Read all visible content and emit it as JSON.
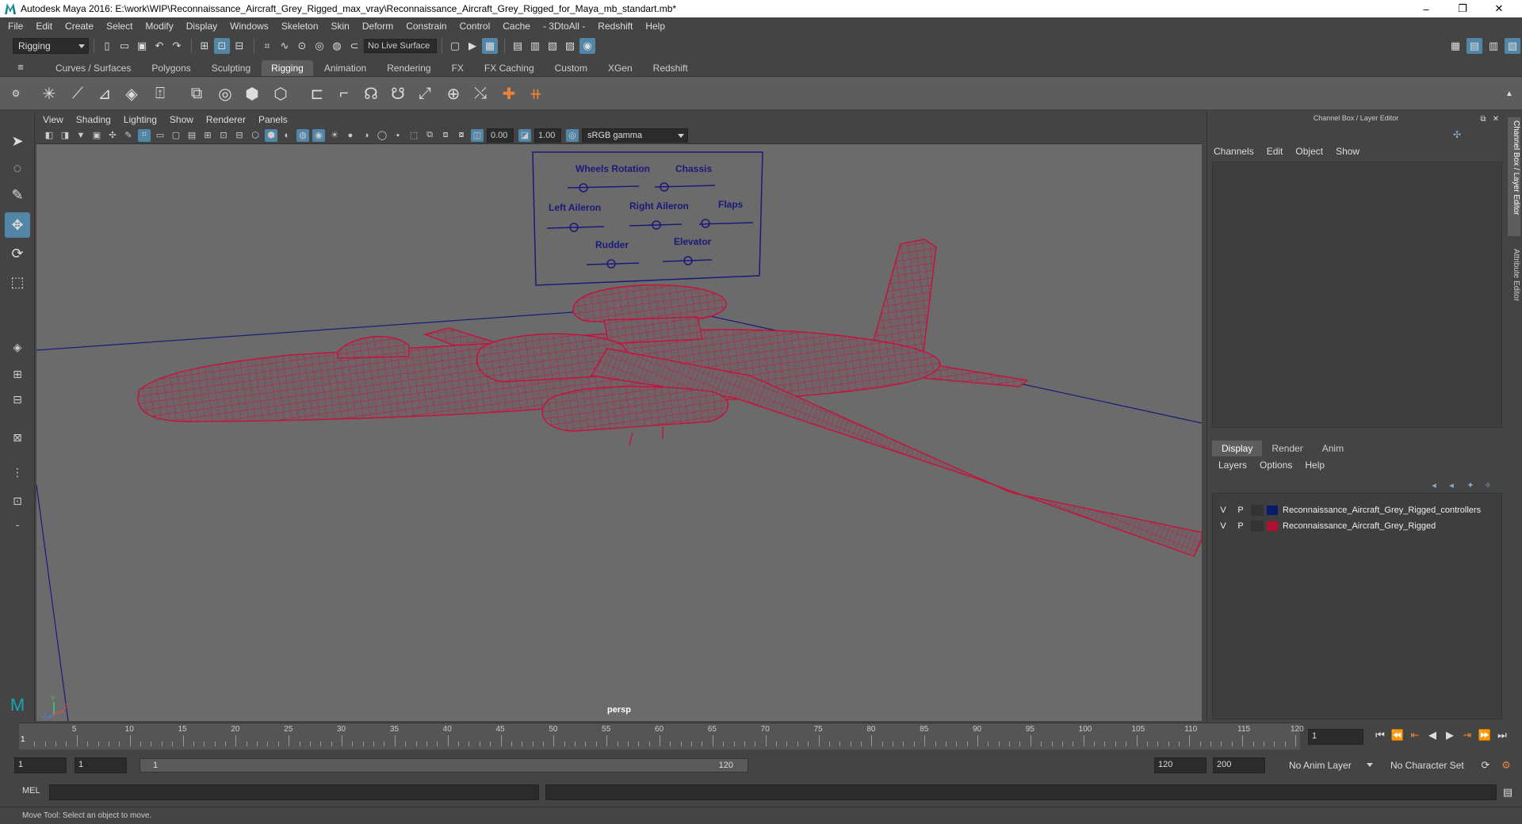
{
  "window": {
    "title": "Autodesk Maya 2016: E:\\work\\WIP\\Reconnaissance_Aircraft_Grey_Rigged_max_vray\\Reconnaissance_Aircraft_Grey_Rigged_for_Maya_mb_standart.mb*",
    "controls": [
      "–",
      "❐",
      "✕"
    ]
  },
  "menubar": [
    "File",
    "Edit",
    "Create",
    "Select",
    "Modify",
    "Display",
    "Windows",
    "Skeleton",
    "Skin",
    "Deform",
    "Constrain",
    "Control",
    "Cache",
    "- 3DtoAll -",
    "Redshift",
    "Help"
  ],
  "statusline": {
    "mode": "Rigging",
    "live_surface": "No Live Surface"
  },
  "shelf": {
    "tabs": [
      "Curves / Surfaces",
      "Polygons",
      "Sculpting",
      "Rigging",
      "Animation",
      "Rendering",
      "FX",
      "FX Caching",
      "Custom",
      "XGen",
      "Redshift"
    ],
    "active_tab": "Rigging"
  },
  "viewport": {
    "menu": [
      "View",
      "Shading",
      "Lighting",
      "Show",
      "Renderer",
      "Panels"
    ],
    "exposure": "0.00",
    "gamma": "1.00",
    "color_space": "sRGB gamma",
    "camera_label": "persp",
    "controller_board": {
      "labels": [
        "Wheels Rotation",
        "Chassis",
        "Left Aileron",
        "Right Aileron",
        "Flaps",
        "Rudder",
        "Elevator"
      ]
    },
    "axis_labels": {
      "y": "Y",
      "z": "Z",
      "x": "X"
    },
    "colors": {
      "wire": "#c8103c",
      "grid_line": "#1a1a7a",
      "board": "#1a1a7a"
    }
  },
  "channel_box": {
    "header": "Channel Box / Layer Editor",
    "menu": [
      "Channels",
      "Edit",
      "Object",
      "Show"
    ]
  },
  "layer_editor": {
    "tabs": [
      "Display",
      "Render",
      "Anim"
    ],
    "active_tab": "Display",
    "menu": [
      "Layers",
      "Options",
      "Help"
    ],
    "layers": [
      {
        "v": "V",
        "p": "P",
        "name": "Reconnaissance_Aircraft_Grey_Rigged_controllers",
        "color": "#0a1a6a"
      },
      {
        "v": "V",
        "p": "P",
        "name": "Reconnaissance_Aircraft_Grey_Rigged",
        "color": "#b0102e"
      }
    ]
  },
  "side_tabs": [
    "Channel Box / Layer Editor",
    "Attribute Editor"
  ],
  "timeline": {
    "ticks": [
      "5",
      "10",
      "15",
      "20",
      "25",
      "30",
      "35",
      "40",
      "45",
      "50",
      "55",
      "60",
      "65",
      "70",
      "75",
      "80",
      "85",
      "90",
      "95",
      "100",
      "105",
      "110",
      "115",
      "120"
    ],
    "current_frame": "1",
    "start_marker": "1",
    "current_time_field": "1"
  },
  "range": {
    "start": "1",
    "start_inner": "1",
    "slider_start": "1",
    "slider_end": "120",
    "end_inner": "120",
    "end": "200",
    "anim_layer": "No Anim Layer",
    "character_set": "No Character Set"
  },
  "command_line": {
    "label": "MEL"
  },
  "help_line": "Move Tool: Select an object to move."
}
